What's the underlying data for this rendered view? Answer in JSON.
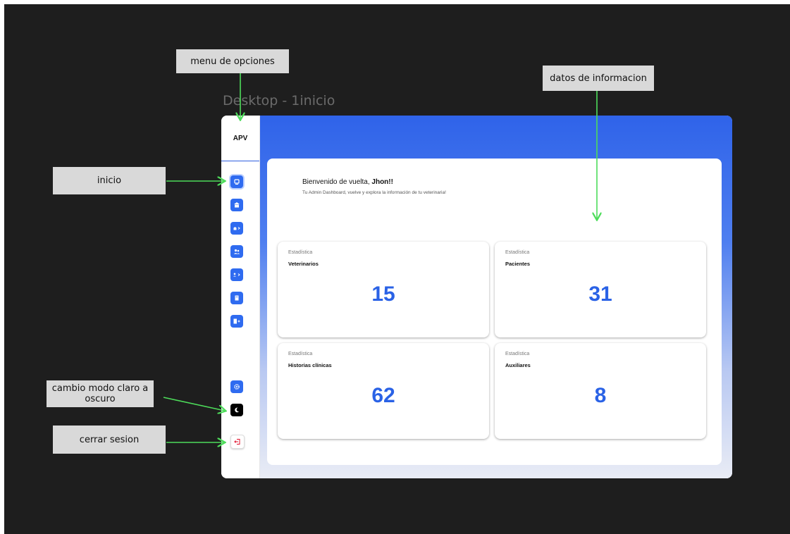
{
  "frame_title": "Desktop - 1inicio",
  "callouts": {
    "menu": "menu de opciones",
    "datos": "datos de informacion",
    "inicio": "inicio",
    "modo": "cambio modo claro a oscuro",
    "cerrar": "cerrar sesion"
  },
  "app": {
    "logo": "APV",
    "welcome_prefix": "Bienvenido de vuelta, ",
    "welcome_name": "Jhon!!",
    "subtitle": "Tu Admin Dashboard, vuelve y explora la información de tu veterinaria!",
    "stats": [
      {
        "kicker": "Estadística",
        "name": "Veterinarios",
        "value": "15"
      },
      {
        "kicker": "Estadística",
        "name": "Pacientes",
        "value": "31"
      },
      {
        "kicker": "Estadística",
        "name": "Historias clínicas",
        "value": "62"
      },
      {
        "kicker": "Estadística",
        "name": "Auxiliares",
        "value": "8"
      }
    ]
  },
  "sidebar_icons": [
    "home-icon",
    "building-icon",
    "building-arrow-icon",
    "users-icon",
    "users-arrow-icon",
    "clipboard-icon",
    "add-doc-icon",
    "settings-icon",
    "moon-icon",
    "logout-icon"
  ],
  "colors": {
    "accent": "#2f6bf0",
    "callout_arrow": "#4ddc5a",
    "stat_value": "#2a62e6"
  }
}
